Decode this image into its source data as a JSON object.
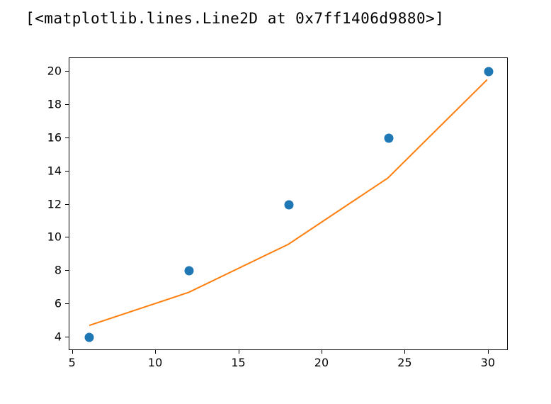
{
  "repr_text": "[<matplotlib.lines.Line2D at 0x7ff1406d9880>]",
  "chart_data": {
    "type": "scatter",
    "title": "",
    "xlabel": "",
    "ylabel": "",
    "xlim": [
      4.8,
      31.2
    ],
    "ylim": [
      3.2,
      20.8
    ],
    "xticks": [
      5,
      10,
      15,
      20,
      25,
      30
    ],
    "yticks": [
      4,
      6,
      8,
      10,
      12,
      14,
      16,
      18,
      20
    ],
    "series": [
      {
        "name": "scatter",
        "type": "scatter",
        "x": [
          6,
          12,
          18,
          24,
          30
        ],
        "y": [
          4,
          8,
          12,
          16,
          20
        ],
        "color": "#1f77b4"
      },
      {
        "name": "line",
        "type": "line",
        "x": [
          6,
          12,
          18,
          24,
          30
        ],
        "y": [
          4.65,
          6.65,
          9.55,
          13.55,
          19.5
        ],
        "color": "#ff7f0e"
      }
    ]
  }
}
